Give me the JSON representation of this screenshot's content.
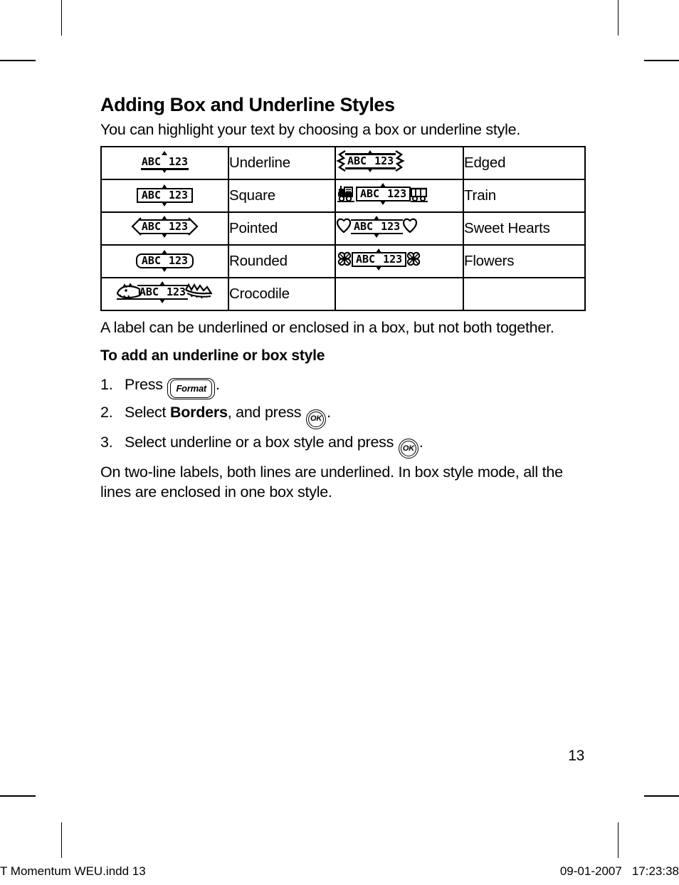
{
  "heading": "Adding Box and Underline Styles",
  "intro": "You can highlight your text by choosing a box or underline style.",
  "label_preview_text": {
    "left": "ABC",
    "right": "123"
  },
  "styles_table": {
    "rows": [
      {
        "left_preview": "underline-style-preview",
        "left_name": "Underline",
        "right_preview": "edged-style-preview",
        "right_name": "Edged"
      },
      {
        "left_preview": "square-style-preview",
        "left_name": "Square",
        "right_preview": "train-style-preview",
        "right_name": "Train"
      },
      {
        "left_preview": "pointed-style-preview",
        "left_name": "Pointed",
        "right_preview": "sweet-hearts-style-preview",
        "right_name": "Sweet Hearts"
      },
      {
        "left_preview": "rounded-style-preview",
        "left_name": "Rounded",
        "right_preview": "flowers-style-preview",
        "right_name": "Flowers"
      },
      {
        "left_preview": "crocodile-style-preview",
        "left_name": "Crocodile",
        "right_preview": "",
        "right_name": ""
      }
    ]
  },
  "note_paragraph": "A label can be underlined or enclosed in a box, but not both together.",
  "procedure_heading": "To add an underline or box style",
  "steps": [
    {
      "number": "1.",
      "before": "Press ",
      "key": "Format",
      "key_type": "rect",
      "bold": "",
      "middle": "",
      "after": "."
    },
    {
      "number": "2.",
      "before": "Select ",
      "bold": "Borders",
      "middle": ", and press ",
      "key": "OK",
      "key_type": "circle",
      "after": "."
    },
    {
      "number": "3.",
      "before": "Select underline or a box style and press ",
      "bold": "",
      "middle": "",
      "key": "OK",
      "key_type": "circle",
      "after": "."
    }
  ],
  "closing_paragraph": "On two-line labels, both lines are underlined. In box style mode, all the lines are enclosed in one box style.",
  "page_number": "13",
  "footer": {
    "file_slug": "T  Momentum WEU.indd   13",
    "date": "09-01-2007",
    "time": "17:23:38"
  }
}
